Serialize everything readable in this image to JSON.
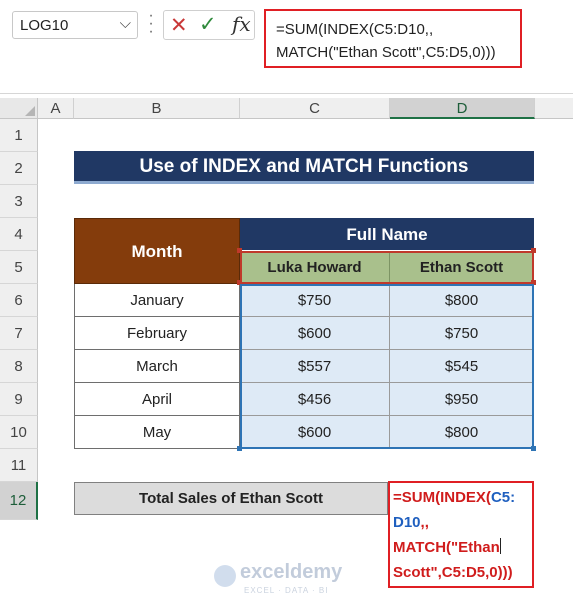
{
  "formula_bar": {
    "name_box": "LOG10",
    "cancel_icon": "✕",
    "enter_icon": "✓",
    "fx_label": "fx",
    "formula_line1": "=SUM(INDEX(C5:D10,,",
    "formula_line2": "MATCH(\"Ethan Scott\",C5:D5,0)))"
  },
  "columns": [
    "A",
    "B",
    "C",
    "D"
  ],
  "rows": [
    "1",
    "2",
    "3",
    "4",
    "5",
    "6",
    "7",
    "8",
    "9",
    "10",
    "11",
    "12"
  ],
  "sheet": {
    "title": "Use of INDEX and MATCH Functions",
    "month_header": "Month",
    "full_name_header": "Full Name",
    "names": [
      "Luka Howard",
      "Ethan Scott"
    ],
    "data": [
      {
        "month": "January",
        "luka": "$750",
        "ethan": "$800"
      },
      {
        "month": "February",
        "luka": "$600",
        "ethan": "$750"
      },
      {
        "month": "March",
        "luka": "$557",
        "ethan": "$545"
      },
      {
        "month": "April",
        "luka": "$456",
        "ethan": "$950"
      },
      {
        "month": "May",
        "luka": "$600",
        "ethan": "$800"
      }
    ],
    "total_label": "Total Sales of Ethan Scott",
    "edit_formula": {
      "p1": "=SUM(INDEX(",
      "p2": "C5:",
      "p3": "D10",
      "p4": ",,",
      "p5": "MATCH(\"Ethan",
      "p6": "Scott\",",
      "p7": "C5:D5",
      "p8": ",0)))"
    }
  },
  "watermark": {
    "name": "exceldemy",
    "tagline": "EXCEL · DATA · BI"
  }
}
